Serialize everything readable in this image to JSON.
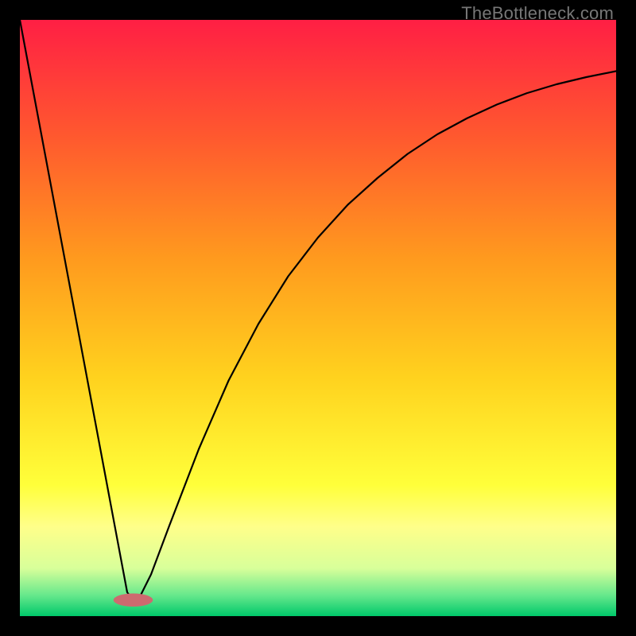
{
  "watermark": "TheBottleneck.com",
  "chart_data": {
    "type": "line",
    "title": "",
    "xlabel": "",
    "ylabel": "",
    "xlim": [
      0,
      100
    ],
    "ylim": [
      0,
      100
    ],
    "grid": false,
    "legend": null,
    "background_gradient_stops": [
      {
        "offset": 0.0,
        "color": "#ff1f44"
      },
      {
        "offset": 0.2,
        "color": "#ff5a2e"
      },
      {
        "offset": 0.4,
        "color": "#ff9a1e"
      },
      {
        "offset": 0.6,
        "color": "#ffd21e"
      },
      {
        "offset": 0.78,
        "color": "#ffff3a"
      },
      {
        "offset": 0.85,
        "color": "#ffff8a"
      },
      {
        "offset": 0.92,
        "color": "#d8ff9a"
      },
      {
        "offset": 0.965,
        "color": "#66e88c"
      },
      {
        "offset": 1.0,
        "color": "#00c86a"
      }
    ],
    "marker": {
      "x": 19,
      "y": 97.3,
      "rx": 3.3,
      "ry": 1.1,
      "fill": "#cd6a6f"
    },
    "series": [
      {
        "name": "curve",
        "color": "#000000",
        "width": 2.2,
        "points": [
          {
            "x": 0.0,
            "y": 0.0
          },
          {
            "x": 18.0,
            "y": 96.0
          },
          {
            "x": 19.0,
            "y": 97.3
          },
          {
            "x": 20.0,
            "y": 97.0
          },
          {
            "x": 22.0,
            "y": 93.0
          },
          {
            "x": 25.0,
            "y": 85.0
          },
          {
            "x": 30.0,
            "y": 72.0
          },
          {
            "x": 35.0,
            "y": 60.5
          },
          {
            "x": 40.0,
            "y": 51.0
          },
          {
            "x": 45.0,
            "y": 43.0
          },
          {
            "x": 50.0,
            "y": 36.5
          },
          {
            "x": 55.0,
            "y": 31.0
          },
          {
            "x": 60.0,
            "y": 26.5
          },
          {
            "x": 65.0,
            "y": 22.5
          },
          {
            "x": 70.0,
            "y": 19.2
          },
          {
            "x": 75.0,
            "y": 16.5
          },
          {
            "x": 80.0,
            "y": 14.2
          },
          {
            "x": 85.0,
            "y": 12.3
          },
          {
            "x": 90.0,
            "y": 10.8
          },
          {
            "x": 95.0,
            "y": 9.6
          },
          {
            "x": 100.0,
            "y": 8.6
          }
        ]
      }
    ]
  }
}
